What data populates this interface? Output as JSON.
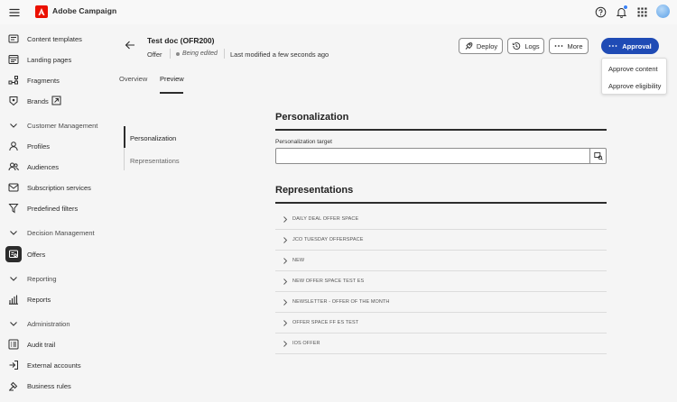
{
  "app": {
    "title": "Adobe Campaign"
  },
  "sidebar": {
    "items": [
      {
        "label": "Content templates",
        "icon": "content-templates-icon"
      },
      {
        "label": "Landing pages",
        "icon": "landing-pages-icon"
      },
      {
        "label": "Fragments",
        "icon": "fragments-icon"
      },
      {
        "label": "Brands",
        "icon": "brands-icon"
      }
    ],
    "customer_management": {
      "label": "Customer Management",
      "items": [
        {
          "label": "Profiles",
          "icon": "profiles-icon"
        },
        {
          "label": "Audiences",
          "icon": "audiences-icon"
        },
        {
          "label": "Subscription services",
          "icon": "subscription-icon"
        },
        {
          "label": "Predefined filters",
          "icon": "filter-icon"
        }
      ]
    },
    "decision_management": {
      "label": "Decision Management",
      "items": [
        {
          "label": "Offers",
          "icon": "offers-icon"
        }
      ]
    },
    "reporting": {
      "label": "Reporting",
      "items": [
        {
          "label": "Reports",
          "icon": "reports-icon"
        }
      ]
    },
    "administration": {
      "label": "Administration",
      "items": [
        {
          "label": "Audit trail",
          "icon": "audit-trail-icon"
        },
        {
          "label": "External accounts",
          "icon": "external-accounts-icon"
        },
        {
          "label": "Business rules",
          "icon": "business-rules-icon"
        }
      ]
    }
  },
  "header": {
    "title": "Test doc (OFR200)",
    "type": "Offer",
    "status": "Being edited",
    "modified": "Last modified a few seconds ago",
    "buttons": {
      "deploy": "Deploy",
      "logs": "Logs",
      "more": "More",
      "approval": "Approval"
    },
    "approval_menu": [
      "Approve content",
      "Approve eligibility"
    ]
  },
  "tabs": [
    {
      "label": "Overview"
    },
    {
      "label": "Preview"
    }
  ],
  "side_nav": [
    {
      "label": "Personalization"
    },
    {
      "label": "Representations"
    }
  ],
  "personalization": {
    "title": "Personalization",
    "field_label": "Personalization target",
    "field_value": ""
  },
  "representations": {
    "title": "Representations",
    "rows": [
      "DAILY DEAL OFFER SPACE",
      "JCO TUESDAY OFFERSPACE",
      "NEW",
      "NEW OFFER SPACE TEST ES",
      "NEWSLETTER - OFFER OF THE MONTH",
      "OFFER SPACE FF ES TEST",
      "IOS OFFER"
    ]
  },
  "colors": {
    "accent": "#1f4bb5",
    "brand": "#eb1000",
    "notification": "#3b82f6"
  }
}
